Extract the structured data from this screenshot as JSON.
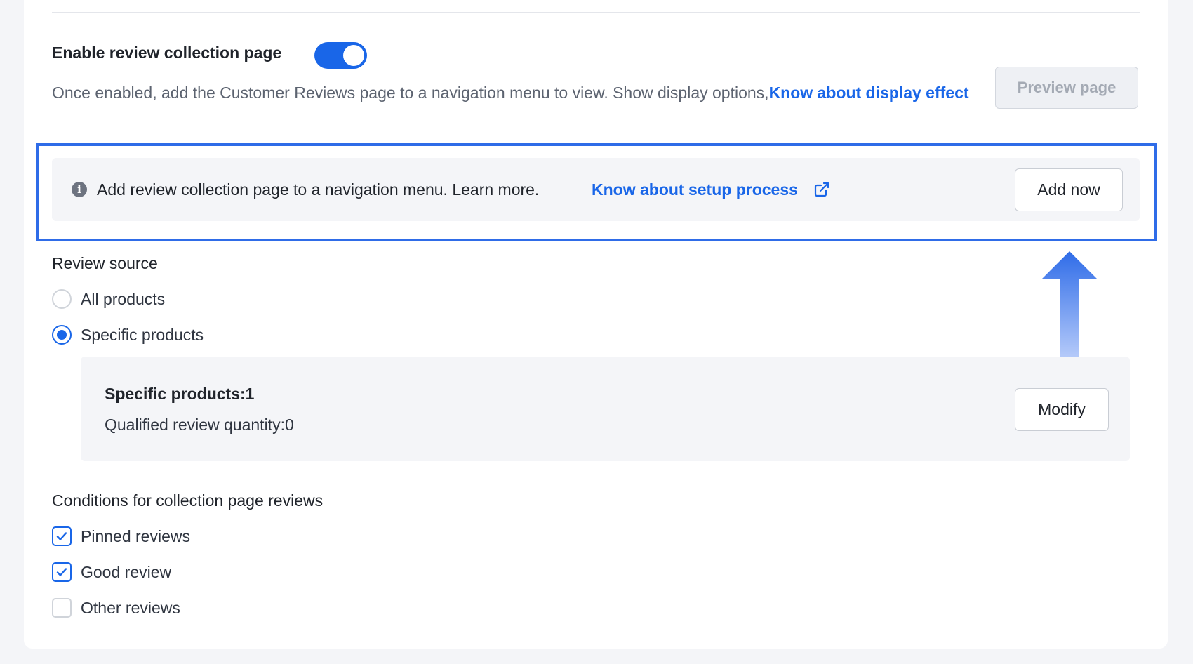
{
  "review_page": {
    "enable_title": "Enable review collection page",
    "toggle_on": true,
    "description": "Once enabled, add the Customer Reviews page to a navigation menu to view. Show display options,",
    "display_link": "Know about display effect",
    "preview_button": "Preview page"
  },
  "notice": {
    "icon": "info-icon",
    "text": "Add review collection page to a navigation menu. Learn more.",
    "setup_link": "Know about setup process",
    "link_icon": "external-link-icon",
    "add_button": "Add now"
  },
  "review_source": {
    "title": "Review source",
    "options": [
      {
        "label": "All products",
        "selected": false
      },
      {
        "label": "Specific products",
        "selected": true
      }
    ],
    "specific_products": "Specific products:1",
    "qualified_quantity": "Qualified review quantity:0",
    "modify_button": "Modify"
  },
  "conditions": {
    "title": "Conditions for collection page reviews",
    "items": [
      {
        "label": "Pinned reviews",
        "checked": true
      },
      {
        "label": "Good review",
        "checked": true
      },
      {
        "label": "Other reviews",
        "checked": false
      }
    ]
  },
  "colors": {
    "accent": "#1966e8",
    "highlight": "#2f6ce8",
    "panel_bg": "#f4f5f8"
  }
}
